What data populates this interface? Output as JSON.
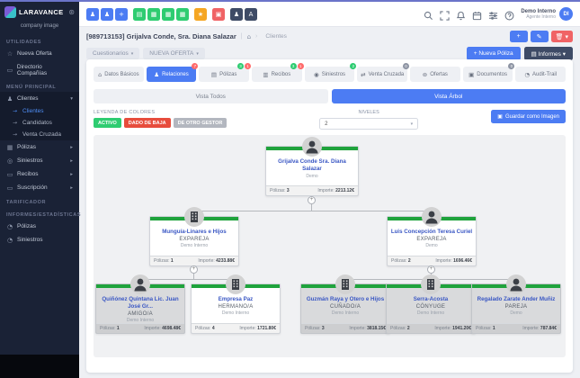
{
  "colors": {
    "accent": "#4c7cf3",
    "green": "#2ecc71",
    "red": "#e74c3c",
    "sidebar": "#1a2236",
    "node_bar": "#1fa33c",
    "other_gestor": "#d9dadc"
  },
  "sidebar": {
    "logo": "LARAVANCE",
    "gear_glyph": "⊛",
    "company": "company image",
    "utilidades_title": "UTILIDADES",
    "nueva_oferta": "Nueva Oferta",
    "directorio": "Directorio Compañías",
    "menu_title": "MENÚ PRINCIPAL",
    "clientes_group": "Clientes",
    "sub_clientes": "Clientes",
    "sub_candidatos": "Candidatos",
    "sub_venta": "Venta Cruzada",
    "polizas": "Pólizas",
    "siniestros": "Siniestros",
    "recibos": "Recibos",
    "suscripcion": "Suscripción",
    "tarificador_title": "TARIFICADOR",
    "informes_title": "INFORMES/ESTADÍSTICAS",
    "inf_polizas": "Pólizas",
    "inf_siniestros": "Siniestros"
  },
  "topbar": {
    "buttons": [
      {
        "glyph": "♟"
      },
      {
        "glyph": "♟"
      },
      {
        "glyph": "+"
      },
      {
        "glyph": "▤"
      },
      {
        "glyph": "▦"
      },
      {
        "glyph": "▦"
      },
      {
        "glyph": "▦"
      },
      {
        "glyph": "★"
      },
      {
        "glyph": "▣"
      },
      {
        "glyph": "♟"
      },
      {
        "glyph": "A"
      }
    ],
    "user": {
      "name": "Demo Interno",
      "role": "Agente Interno",
      "initials": "DI"
    }
  },
  "header": {
    "title": "[989713153] Grijalva Conde, Sra. Diana Salazar",
    "home_glyph": "⌂",
    "breadcrumb": "Clientes",
    "plus": "+",
    "edit": "✎",
    "trash": "🗑",
    "caret": "▾"
  },
  "actions": {
    "cuestionarios": "Cuestionarios",
    "nueva_oferta": "NUEVA OFERTA",
    "nueva_poliza": "+ Nueva Póliza",
    "informes": "Informes",
    "informes_icon": "▤"
  },
  "tabs": [
    {
      "icon": "⌂",
      "label": "Datos Básicos"
    },
    {
      "icon": "♟",
      "label": "Relaciones",
      "badge_r": "7"
    },
    {
      "icon": "▤",
      "label": "Pólizas",
      "badge_g": "3",
      "badge_r": "1"
    },
    {
      "icon": "▥",
      "label": "Recibos",
      "badge_g": "3",
      "badge_r": "1"
    },
    {
      "icon": "◉",
      "label": "Siniestros",
      "badge_g": "2"
    },
    {
      "icon": "⇄",
      "label": "Venta Cruzada",
      "badge_k": "0"
    },
    {
      "icon": "⊚",
      "label": "Ofertas"
    },
    {
      "icon": "▣",
      "label": "Documentos",
      "badge_k": "0"
    },
    {
      "icon": "◔",
      "label": "Audit-Trail"
    }
  ],
  "view_toggle": {
    "all": "Vista Todos",
    "tree": "Vista Árbol"
  },
  "legend": {
    "title": "LEYENDA DE COLORES",
    "activo": "ACTIVO",
    "baja": "DADO DE BAJA",
    "otro": "DE OTRO GESTOR"
  },
  "niveles": {
    "label": "NIVELES",
    "value": "2",
    "caret": "▾"
  },
  "save_image": {
    "icon": "▣",
    "label": "Guardar como Imagen"
  },
  "tree": {
    "expand_glyph": "+",
    "labels": {
      "polizas": "Pólizas:",
      "importe": "Importe:"
    },
    "nodes": [
      {
        "name": "Grijalva Conde Sra. Diana Salazar",
        "relation": "",
        "gestor": "Demo",
        "polizas": "3",
        "importe": "2213.12€"
      },
      {
        "name": "Munguía-Linares e Hijos",
        "relation": "EXPAREJA",
        "gestor": "Demo Interno",
        "polizas": "1",
        "importe": "4233.88€"
      },
      {
        "name": "Luis Concepción Teresa Curiel",
        "relation": "EXPAREJA",
        "gestor": "Demo",
        "polizas": "2",
        "importe": "1696.46€"
      },
      {
        "name": "Quiñónez Quintana Lic. Juan José Gr...",
        "relation": "AMIGO/A",
        "gestor": "Demo Interno",
        "polizas": "1",
        "importe": "4698.48€"
      },
      {
        "name": "Empresa Paz",
        "relation": "HERMANO/A",
        "gestor": "Demo Interno",
        "polizas": "4",
        "importe": "1721.80€"
      },
      {
        "name": "Guzmán Raya y Otero e Hijos",
        "relation": "CUÑADO/A",
        "gestor": "Demo Interno",
        "polizas": "3",
        "importe": "3818.15€"
      },
      {
        "name": "Serra-Acosta",
        "relation": "CÓNYUGE",
        "gestor": "Demo Interno",
        "polizas": "2",
        "importe": "1941.20€"
      },
      {
        "name": "Regalado Zarate Ander Muñiz",
        "relation": "PAREJA",
        "gestor": "Demo",
        "polizas": "1",
        "importe": "787.84€"
      }
    ]
  }
}
